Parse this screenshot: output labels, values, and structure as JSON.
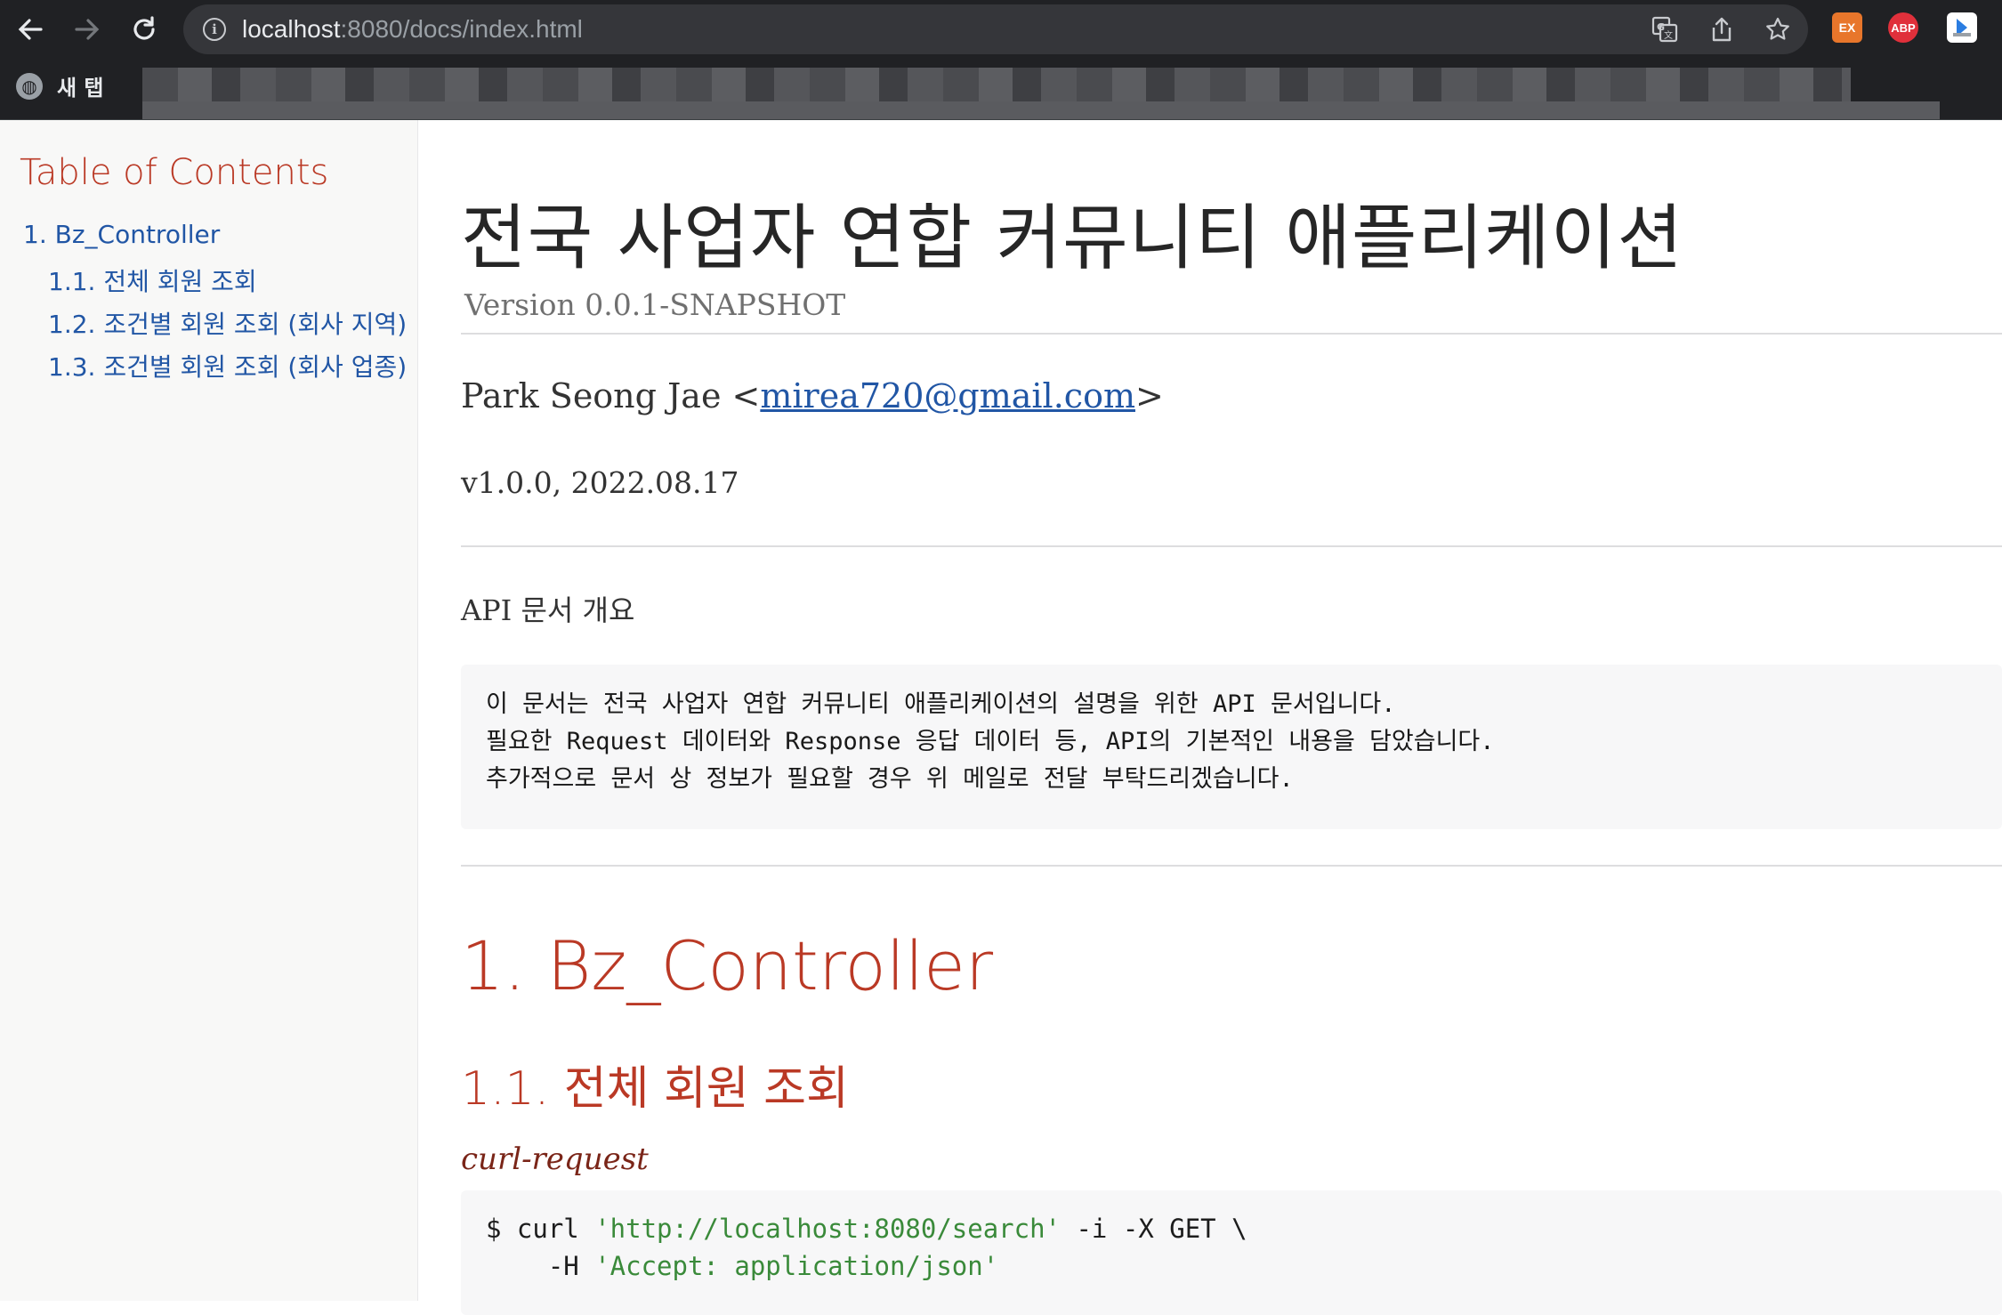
{
  "browser": {
    "back_icon": "arrow-left-icon",
    "forward_icon": "arrow-right-icon",
    "reload_icon": "reload-icon",
    "url_host": "localhost",
    "url_path": ":8080/docs/index.html",
    "translate_icon": "translate-icon",
    "share_icon": "share-icon",
    "star_icon": "star-icon",
    "extensions": [
      {
        "label": "EX",
        "color": "#e8762b"
      },
      {
        "label": "ABP",
        "color": "#e0303b"
      }
    ],
    "bookmarks_bar": {
      "new_tab_label": "새 탭"
    }
  },
  "sidebar": {
    "title": "Table of Contents",
    "items": [
      {
        "label": "1. Bz_Controller",
        "level": 1
      },
      {
        "label": "1.1. 전체 회원 조회",
        "level": 2
      },
      {
        "label": "1.2. 조건별 회원 조회 (회사 지역)",
        "level": 2
      },
      {
        "label": "1.3. 조건별 회원 조회 (회사 업종)",
        "level": 2
      }
    ]
  },
  "doc": {
    "title": "전국 사업자 연합 커뮤니티 애플리케이션",
    "version": "Version 0.0.1-SNAPSHOT",
    "author_name": "Park Seong Jae <",
    "author_email": "mirea720@gmail.com",
    "author_suffix": ">",
    "revision": "v1.0.0, 2022.08.17",
    "overview_title": "API 문서 개요",
    "overview_lines": [
      "이 문서는 전국 사업자 연합 커뮤니티 애플리케이션의 설명을 위한 API 문서입니다.",
      "필요한 Request 데이터와 Response 응답 데이터 등, API의 기본적인 내용을 담았습니다.",
      "추가적으로 문서 상 정보가 필요할 경우 위 메일로 전달 부탁드리겠습니다."
    ],
    "section_title": "1. Bz_Controller",
    "subsection_title": "1.1. 전체 회원 조회",
    "snippet_title": "curl-request",
    "code": {
      "line1_prefix": "$ curl ",
      "line1_url": "'http://localhost:8080/search'",
      "line1_suffix": " -i -X GET \\",
      "line2_prefix": "    -H ",
      "line2_header": "'Accept: application/json'"
    }
  }
}
